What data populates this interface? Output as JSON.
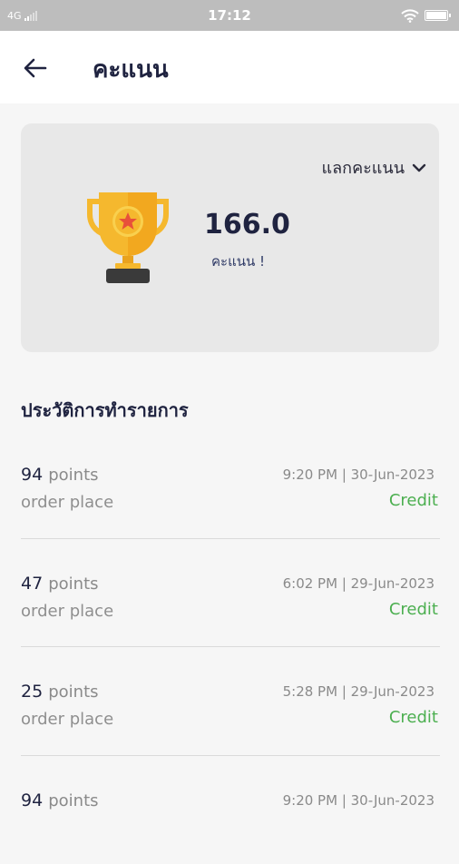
{
  "status_bar": {
    "network": "4G",
    "time": "17:12",
    "icons": [
      "signal-icon",
      "wifi-icon",
      "battery-icon"
    ]
  },
  "header": {
    "back_icon": "arrow-left-icon",
    "title": "คะแนน"
  },
  "points_card": {
    "redeem_label": "แลกคะแนน",
    "redeem_icon": "chevron-down-icon",
    "trophy_icon": "trophy-icon",
    "points_value": "166.0",
    "points_label": "คะแนน !"
  },
  "history": {
    "title": "ประวัติการทำรายการ",
    "items": [
      {
        "points": "94",
        "unit": "points",
        "description": "order place",
        "datetime": "9:20 PM | 30-Jun-2023",
        "type": "Credit"
      },
      {
        "points": "47",
        "unit": "points",
        "description": "order place",
        "datetime": "6:02 PM | 29-Jun-2023",
        "type": "Credit"
      },
      {
        "points": "25",
        "unit": "points",
        "description": "order place",
        "datetime": "5:28 PM | 29-Jun-2023",
        "type": "Credit"
      },
      {
        "points": "94",
        "unit": "points",
        "description": "",
        "datetime": "9:20 PM | 30-Jun-2023",
        "type": ""
      }
    ]
  },
  "colors": {
    "status_bar": "#bdbdbd",
    "card": "#e8e8e8",
    "credit": "#4caf50",
    "title": "#1f2340",
    "trophy_gold": "#f5b82e"
  }
}
